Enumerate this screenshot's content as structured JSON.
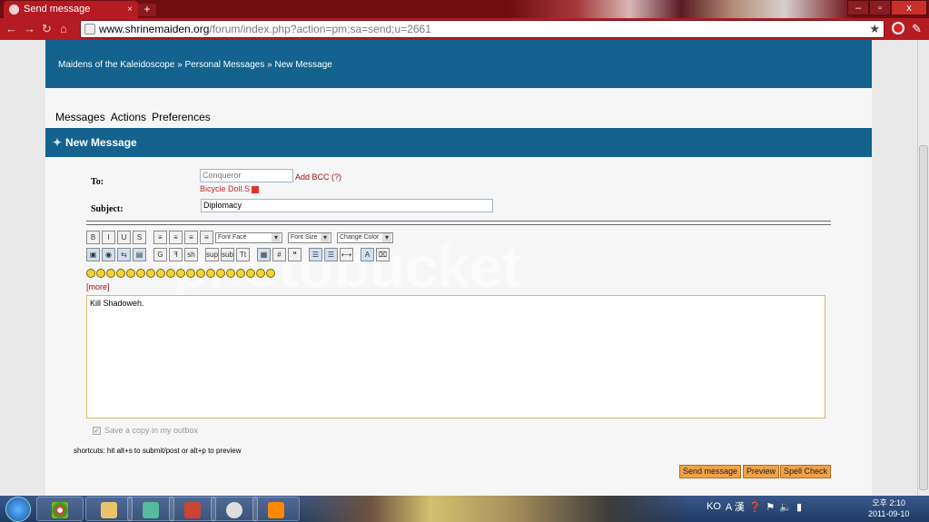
{
  "browser": {
    "tab_title": "Send message",
    "tab_close": "×",
    "new_tab": "+",
    "url_host": "www.shrinemaiden.org",
    "url_path": "/forum/index.php?action=pm;sa=send;u=2661",
    "back_icon": "back-arrow-icon",
    "forward_icon": "forward-arrow-icon",
    "reload_icon": "reload-icon",
    "home_icon": "home-icon",
    "star_icon": "★",
    "window_minimize": "–",
    "window_maximize": "▫",
    "window_close": "x"
  },
  "forum": {
    "breadcrumb": "Maidens of the Kaleidoscope » Personal Messages » New Message",
    "menu": [
      "Messages",
      "Actions",
      "Preferences"
    ],
    "collapse": "◁◁",
    "page_title": "New Message"
  },
  "form": {
    "to_label": "To:",
    "to_value": "Conqueror",
    "add_bcc": "Add BCC (?)",
    "recipient": "Bicycle Doll.S",
    "subject_label": "Subject:",
    "subject_value": "Diplomacy",
    "toolbar_row1": [
      "B",
      "I",
      "U",
      "S",
      "≡",
      "≡",
      "≡",
      "≡"
    ],
    "font_face": "Font Face",
    "font_size": "Font Size",
    "change_color": "Change Color",
    "toolbar_row2": [
      "▣",
      "◉",
      "⇆",
      "▤",
      "G",
      "ꟻ",
      "sh",
      "sup",
      "sub",
      "Tt",
      "▦",
      "#",
      "❝",
      "☰",
      "☰",
      "⟷",
      "A",
      "⌧"
    ],
    "smiley_count": 19,
    "more": "[more]",
    "message": "Kill Shadoweh.",
    "save_copy": "Save a copy in my outbox",
    "shortcuts": "shortcuts: hit alt+s to submit/post or alt+p to preview",
    "send": "Send message",
    "preview": "Preview",
    "spellcheck": "Spell Check"
  },
  "taskbar": {
    "tray_lang": "KO",
    "tray_ime": "A 漢",
    "clock_time": "오후 2:10",
    "clock_date": "2011-09-10"
  },
  "colors": {
    "chrome_red": "#b41b22",
    "forum_blue": "#14628e",
    "button_orange": "#f0a24a",
    "link_red": "#a01010"
  }
}
